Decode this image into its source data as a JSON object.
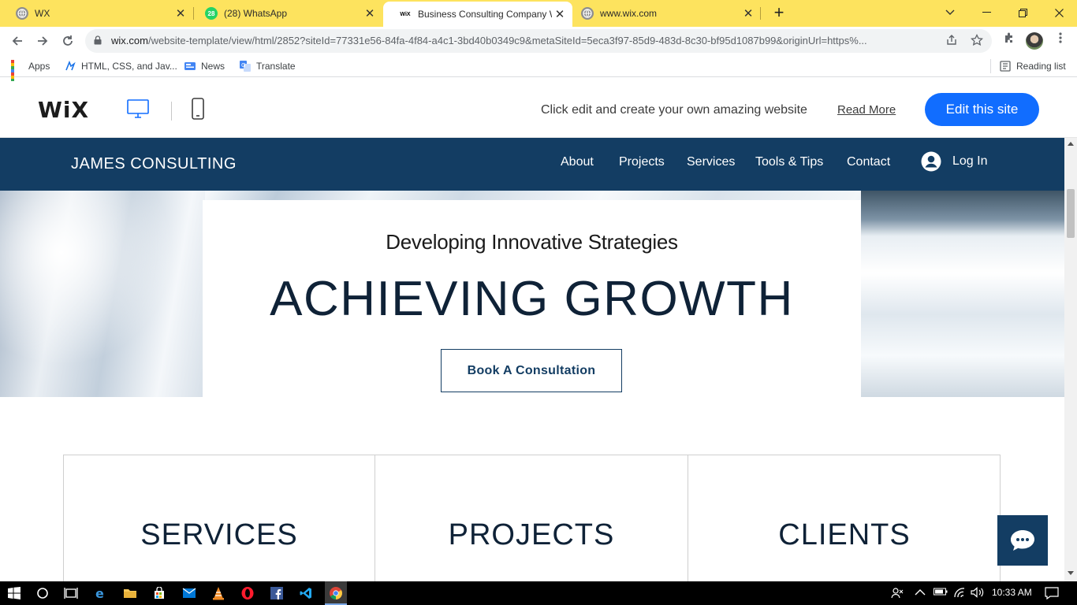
{
  "browser": {
    "tabs": [
      {
        "title": "WX",
        "favicon": "globe-icon",
        "active": false
      },
      {
        "title": "(28) WhatsApp",
        "favicon": "whatsapp-icon",
        "badge": "28",
        "active": false
      },
      {
        "title": "Business Consulting Company W",
        "favicon": "wix-icon",
        "active": true
      },
      {
        "title": "www.wix.com",
        "favicon": "globe-icon",
        "active": false
      }
    ],
    "url_host": "wix.com",
    "url_rest": "/website-template/view/html/2852?siteId=77331e56-84fa-4f84-a4c1-3bd40b0349c9&metaSiteId=5eca3f97-85d9-483d-8c30-bf95d1087b99&originUrl=https%...",
    "bookmarks": [
      {
        "label": "Apps",
        "icon": "apps-grid-icon"
      },
      {
        "label": "HTML, CSS, and Jav...",
        "icon": "bookmark-icon"
      },
      {
        "label": "News",
        "icon": "news-icon"
      },
      {
        "label": "Translate",
        "icon": "translate-icon"
      }
    ],
    "reading_list": "Reading list"
  },
  "wix_bar": {
    "logo": "WiX",
    "message": "Click edit and create your own amazing website",
    "read_more": "Read More",
    "edit_button": "Edit this site",
    "accent": "#116dff"
  },
  "site": {
    "brand": "JAMES CONSULTING",
    "nav": [
      "About",
      "Projects",
      "Services",
      "Tools & Tips",
      "Contact"
    ],
    "login": "Log In",
    "hero_subtitle": "Developing Innovative Strategies",
    "hero_title": "ACHIEVING GROWTH",
    "hero_button": "Book A Consultation",
    "cards": [
      "SERVICES",
      "PROJECTS",
      "CLIENTS"
    ],
    "nav_color": "#133d63"
  },
  "taskbar": {
    "clock": "10:33 AM"
  }
}
